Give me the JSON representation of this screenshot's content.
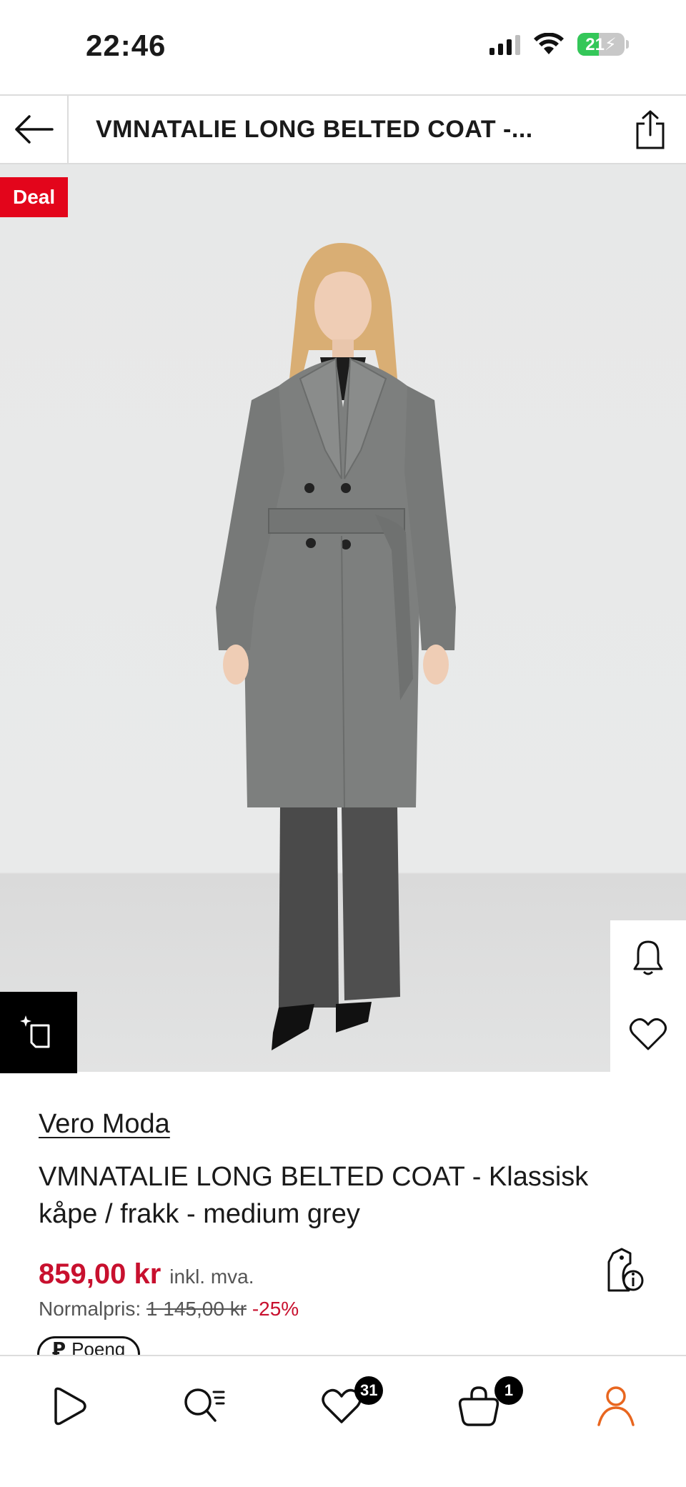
{
  "status_bar": {
    "time": "22:46",
    "battery_level": "21",
    "icons": [
      "cellular-signal-icon",
      "wifi-icon",
      "battery-charging-icon"
    ]
  },
  "header": {
    "title": "VMNATALIE LONG BELTED COAT -...",
    "back_icon": "arrow-left-icon",
    "share_icon": "share-icon"
  },
  "product_image": {
    "badge": "Deal",
    "side_actions": [
      "bell-icon",
      "heart-icon"
    ],
    "save_look_icon": "crop-sparkle-icon"
  },
  "product": {
    "brand": "Vero Moda",
    "name": "VMNATALIE LONG BELTED COAT - Klassisk kåpe / frakk - medium grey",
    "price": "859,00 kr",
    "vat_note": "inkl. mva.",
    "normal_price_label": "Normalpris:",
    "normal_price": "1 145,00 kr",
    "discount": "-25%",
    "price_info_icon": "price-tag-info-icon",
    "points_label": "Poeng",
    "points_icon": "p-icon"
  },
  "bottom_nav": {
    "items": [
      {
        "name": "play-icon"
      },
      {
        "name": "search-list-icon"
      },
      {
        "name": "heart-icon",
        "badge": "31"
      },
      {
        "name": "bag-icon",
        "badge": "1"
      },
      {
        "name": "user-icon"
      }
    ],
    "accent_color": "#e8661f"
  },
  "colors": {
    "deal_red": "#e3051b",
    "price_red": "#c8102e"
  }
}
